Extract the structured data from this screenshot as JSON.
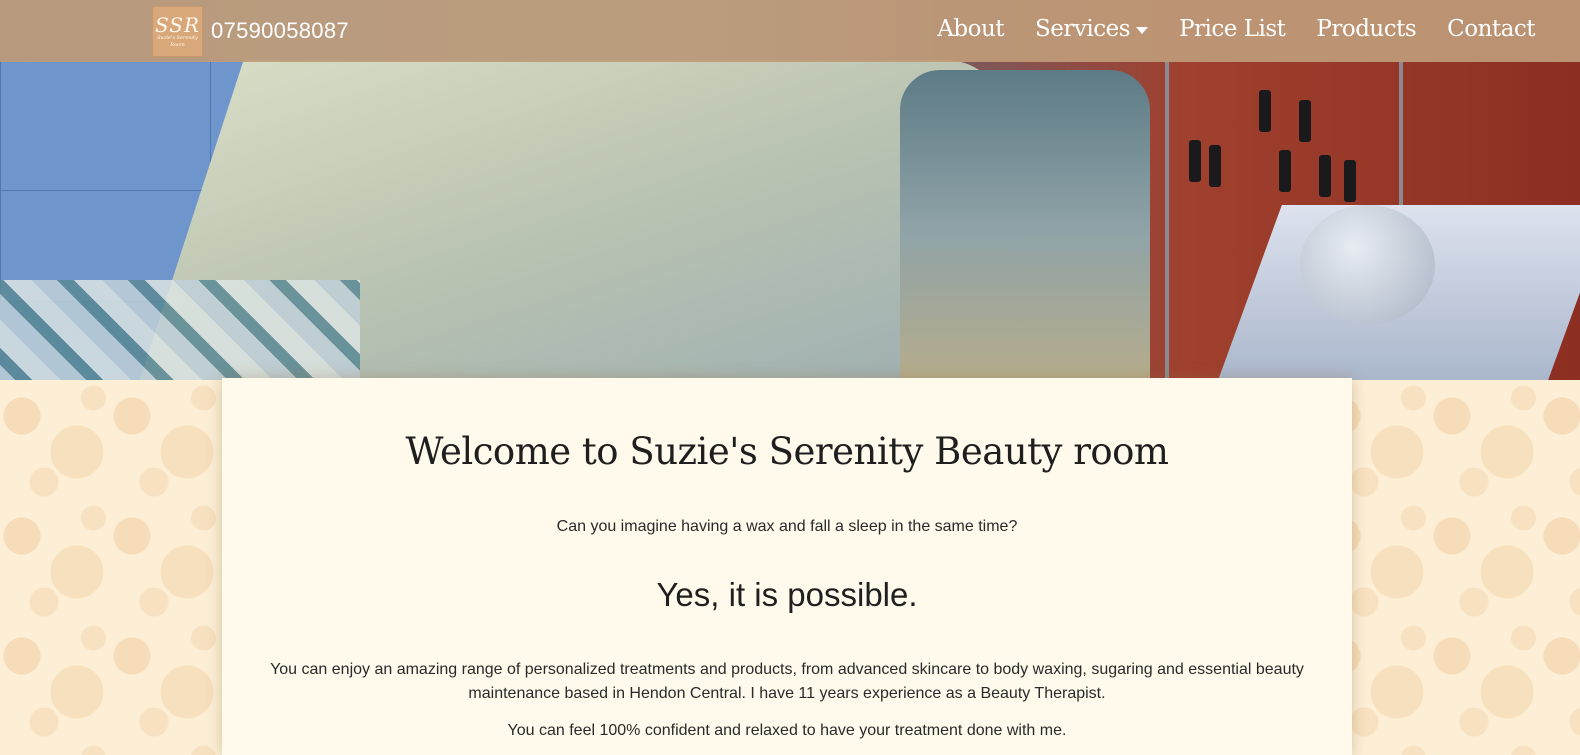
{
  "navbar": {
    "logo": {
      "big": "SSR",
      "small": "Suzie's Serenity Room"
    },
    "phone": "07590058087",
    "links": [
      {
        "label": "About"
      },
      {
        "label": "Services"
      },
      {
        "label": "Price List"
      },
      {
        "label": "Products"
      },
      {
        "label": "Contact"
      }
    ]
  },
  "content": {
    "title": "Welcome to Suzie's Serenity Beauty room",
    "question": "Can you imagine having a wax and fall a sleep in the same time?",
    "answer": "Yes, it is possible.",
    "paragraph1": "You can enjoy an amazing range of personalized treatments and products, from advanced skincare to body waxing, sugaring and essential beauty maintenance based in Hendon Central. I have 11 years experience as a Beauty Therapist.",
    "paragraph2": "You can feel 100% confident and relaxed to have your treatment done with me."
  },
  "colors": {
    "navbar": "#be9b78",
    "card": "#fffaec",
    "page": "#fcefd6"
  }
}
